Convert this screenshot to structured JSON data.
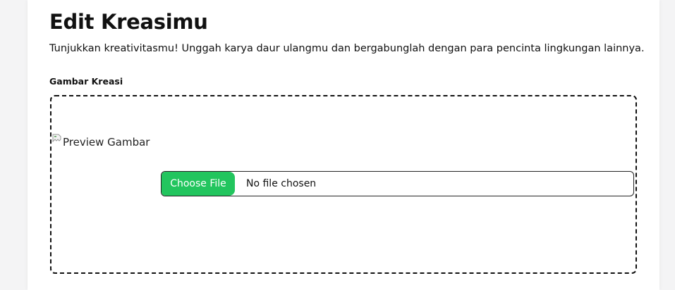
{
  "page": {
    "title": "Edit Kreasimu",
    "subtitle": "Tunjukkan kreativitasmu! Unggah karya daur ulangmu dan bergabunglah dengan para pencinta lingkungan lainnya."
  },
  "form": {
    "image_field": {
      "label": "Gambar Kreasi",
      "preview_alt": "Preview Gambar",
      "choose_button_label": "Choose File",
      "file_status": "No file chosen",
      "icon": "broken-image-icon"
    }
  },
  "colors": {
    "accent": "#22c55e",
    "background": "#f4f4f5",
    "card": "#ffffff",
    "text": "#111111"
  }
}
